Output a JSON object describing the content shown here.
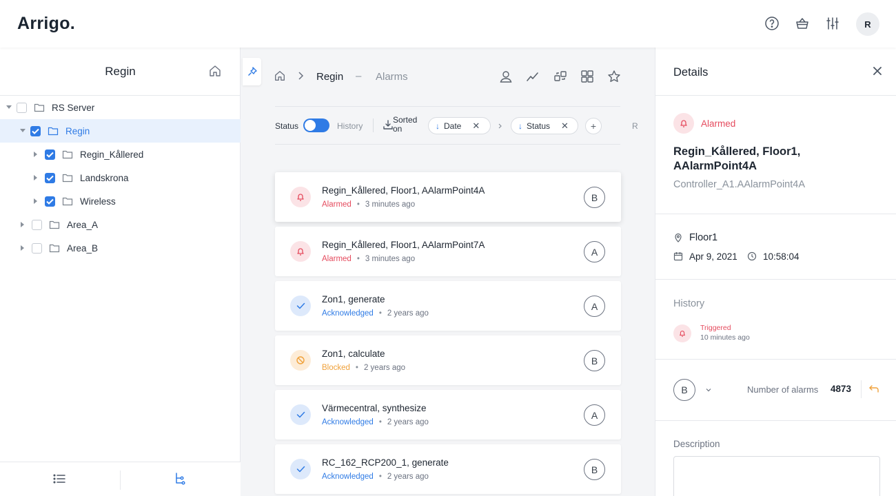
{
  "app": {
    "logo": "Arrigo.",
    "avatar_initial": "R"
  },
  "tree": {
    "title": "Regin",
    "items": [
      {
        "label": "RS Server",
        "checked": false,
        "selected": false
      },
      {
        "label": "Regin",
        "checked": true,
        "selected": true
      },
      {
        "label": "Regin_Kållered",
        "checked": true,
        "selected": false
      },
      {
        "label": "Landskrona",
        "checked": true,
        "selected": false
      },
      {
        "label": "Wireless",
        "checked": true,
        "selected": false
      },
      {
        "label": "Area_A",
        "checked": false,
        "selected": false
      },
      {
        "label": "Area_B",
        "checked": false,
        "selected": false
      }
    ]
  },
  "breadcrumb": {
    "current": "Regin",
    "separator": "–",
    "section": "Alarms"
  },
  "filters": {
    "status_label": "Status",
    "history_label": "History",
    "sorted_line1": "Sorted",
    "sorted_line2": "on",
    "chips": [
      {
        "label": "Date"
      },
      {
        "label": "Status"
      }
    ],
    "plus": "+",
    "truncated": "Re"
  },
  "alarms": [
    {
      "title": "Regin_Kållered, Floor1, AAlarmPoint4A",
      "status": "Alarmed",
      "time": "3 minutes ago",
      "priority": "B",
      "kind": "alarm"
    },
    {
      "title": "Regin_Kållered, Floor1, AAlarmPoint7A",
      "status": "Alarmed",
      "time": "3 minutes ago",
      "priority": "A",
      "kind": "alarm"
    },
    {
      "title": "Zon1, generate",
      "status": "Acknowledged",
      "time": "2 years ago",
      "priority": "A",
      "kind": "ack"
    },
    {
      "title": "Zon1, calculate",
      "status": "Blocked",
      "time": "2 years ago",
      "priority": "B",
      "kind": "block"
    },
    {
      "title": "Värmecentral, synthesize",
      "status": "Acknowledged",
      "time": "2 years ago",
      "priority": "A",
      "kind": "ack"
    },
    {
      "title": "RC_162_RCP200_1, generate",
      "status": "Acknowledged",
      "time": "2 years ago",
      "priority": "B",
      "kind": "ack"
    }
  ],
  "details": {
    "title": "Details",
    "status": "Alarmed",
    "name": "Regin_Kållered, Floor1, AAlarmPoint4A",
    "sub": "Controller_A1.AAlarmPoint4A",
    "location": "Floor1",
    "date": "Apr 9, 2021",
    "time": "10:58:04",
    "history_label": "History",
    "history": [
      {
        "event": "Triggered",
        "time": "10 minutes ago"
      }
    ],
    "priority": "B",
    "number_label": "Number of alarms",
    "number_value": "4873",
    "description_label": "Description"
  },
  "colors": {
    "accent": "#2f7be5",
    "alarm": "#e54b5e",
    "blocked": "#f0a13a"
  }
}
